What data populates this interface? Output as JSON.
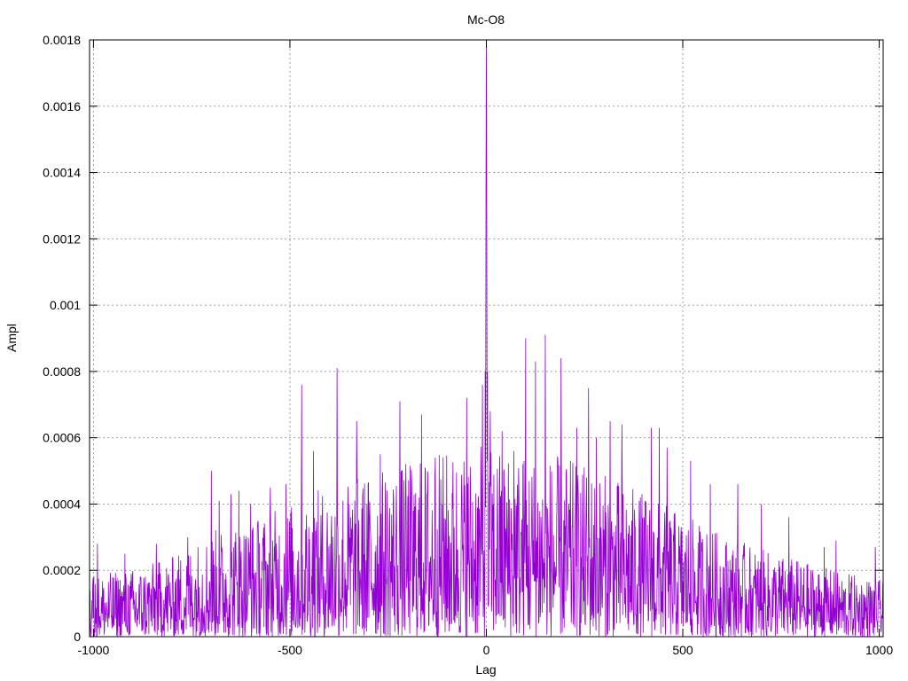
{
  "chart_data": {
    "type": "line",
    "title": "Mc-O8",
    "xlabel": "Lag",
    "ylabel": "Ampl",
    "xlim": [
      -1010,
      1010
    ],
    "ylim": [
      0,
      0.0018
    ],
    "xticks": [
      {
        "value": -1000,
        "label": "-1000"
      },
      {
        "value": -500,
        "label": "-500"
      },
      {
        "value": 0,
        "label": "0"
      },
      {
        "value": 500,
        "label": "500"
      },
      {
        "value": 1000,
        "label": "1000"
      }
    ],
    "yticks": [
      {
        "value": 0,
        "label": "0"
      },
      {
        "value": 0.0002,
        "label": "0.0002"
      },
      {
        "value": 0.0004,
        "label": "0.0004"
      },
      {
        "value": 0.0006,
        "label": "0.0006"
      },
      {
        "value": 0.0008,
        "label": "0.0008"
      },
      {
        "value": 0.001,
        "label": "0.001"
      },
      {
        "value": 0.0012,
        "label": "0.0012"
      },
      {
        "value": 0.0014,
        "label": "0.0014"
      },
      {
        "value": 0.0016,
        "label": "0.0016"
      },
      {
        "value": 0.0018,
        "label": "0.0018"
      }
    ],
    "grid": true,
    "legend": "none",
    "series": [
      {
        "color": "#9400d3",
        "x_range": [
          -1010,
          1010
        ],
        "x_step": 1,
        "envelope": [
          [
            -1010,
            0.00016
          ],
          [
            -900,
            0.00018
          ],
          [
            -800,
            0.00021
          ],
          [
            -700,
            0.00028
          ],
          [
            -600,
            0.00031
          ],
          [
            -500,
            0.00035
          ],
          [
            -400,
            0.0004
          ],
          [
            -300,
            0.00043
          ],
          [
            -200,
            0.00046
          ],
          [
            -100,
            0.00049
          ],
          [
            0,
            0.0005
          ],
          [
            100,
            0.00049
          ],
          [
            200,
            0.00047
          ],
          [
            300,
            0.00043
          ],
          [
            400,
            0.00038
          ],
          [
            500,
            0.00032
          ],
          [
            600,
            0.00027
          ],
          [
            700,
            0.00023
          ],
          [
            800,
            0.0002
          ],
          [
            900,
            0.00017
          ],
          [
            1010,
            0.00015
          ]
        ],
        "peaks": [
          {
            "x": -1,
            "y": 0.00137
          },
          {
            "x": 0,
            "y": 0.0018
          },
          {
            "x": 1,
            "y": 0.0013
          },
          {
            "x": -3,
            "y": 0.0008
          },
          {
            "x": 3,
            "y": 0.0008
          },
          {
            "x": -10,
            "y": 0.00076
          },
          {
            "x": 10,
            "y": 0.00068
          },
          {
            "x": 150,
            "y": 0.00091
          },
          {
            "x": 100,
            "y": 0.0009
          },
          {
            "x": 190,
            "y": 0.00084
          },
          {
            "x": 125,
            "y": 0.00083
          },
          {
            "x": -380,
            "y": 0.00081
          },
          {
            "x": -470,
            "y": 0.00076
          },
          {
            "x": 260,
            "y": 0.00075
          },
          {
            "x": -50,
            "y": 0.00072
          },
          {
            "x": -220,
            "y": 0.00071
          },
          {
            "x": -165,
            "y": 0.00067
          },
          {
            "x": -330,
            "y": 0.00065
          },
          {
            "x": 315,
            "y": 0.00065
          },
          {
            "x": 345,
            "y": 0.00064
          },
          {
            "x": 230,
            "y": 0.00063
          },
          {
            "x": -10,
            "y": 0.00063
          },
          {
            "x": 440,
            "y": 0.00063
          },
          {
            "x": 420,
            "y": 0.00063
          },
          {
            "x": 40,
            "y": 0.00062
          },
          {
            "x": -440,
            "y": 0.00056
          },
          {
            "x": -270,
            "y": 0.00055
          },
          {
            "x": -130,
            "y": 0.00054
          },
          {
            "x": 70,
            "y": 0.00056
          },
          {
            "x": 280,
            "y": 0.0006
          },
          {
            "x": -700,
            "y": 0.0005
          },
          {
            "x": 460,
            "y": 0.00057
          },
          {
            "x": 520,
            "y": 0.00053
          },
          {
            "x": -630,
            "y": 0.00044
          },
          {
            "x": -510,
            "y": 0.00046
          },
          {
            "x": -550,
            "y": 0.00045
          },
          {
            "x": -600,
            "y": 0.0004
          },
          {
            "x": -650,
            "y": 0.00043
          },
          {
            "x": -680,
            "y": 0.00041
          },
          {
            "x": 570,
            "y": 0.00046
          },
          {
            "x": 640,
            "y": 0.00046
          },
          {
            "x": 700,
            "y": 0.0004
          },
          {
            "x": 770,
            "y": 0.00036
          },
          {
            "x": -840,
            "y": 0.00028
          },
          {
            "x": -760,
            "y": 0.0003
          },
          {
            "x": -990,
            "y": 0.00028
          },
          {
            "x": -920,
            "y": 0.00025
          },
          {
            "x": 890,
            "y": 0.00029
          },
          {
            "x": 990,
            "y": 0.00027
          },
          {
            "x": 860,
            "y": 0.00027
          }
        ],
        "seed": 8
      }
    ]
  }
}
